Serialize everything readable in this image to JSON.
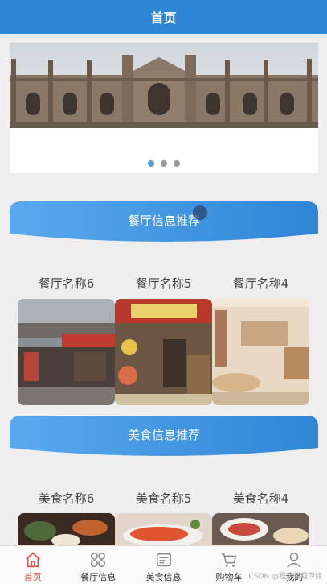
{
  "header": {
    "title": "首页"
  },
  "carousel": {
    "dot_count": 3,
    "active_index": 0
  },
  "restaurant_section": {
    "title": "餐厅信息推荐",
    "items": [
      {
        "name": "餐厅名称6"
      },
      {
        "name": "餐厅名称5"
      },
      {
        "name": "餐厅名称4"
      }
    ]
  },
  "food_section": {
    "title": "美食信息推荐",
    "items": [
      {
        "name": "美食名称6"
      },
      {
        "name": "美食名称5"
      },
      {
        "name": "美食名称4"
      }
    ]
  },
  "tabbar": {
    "items": [
      {
        "label": "首页",
        "icon": "home-icon",
        "active": true
      },
      {
        "label": "餐厅信息",
        "icon": "grid-icon",
        "active": false
      },
      {
        "label": "美食信息",
        "icon": "news-icon",
        "active": false
      },
      {
        "label": "购物车",
        "icon": "cart-icon",
        "active": false
      },
      {
        "label": "我的",
        "icon": "user-icon",
        "active": false
      }
    ]
  },
  "watermark": "CSDN @程序猿葫芦娃",
  "colors": {
    "primary": "#2f86d6",
    "active_tab": "#d9534f",
    "background": "#eeeeee"
  }
}
